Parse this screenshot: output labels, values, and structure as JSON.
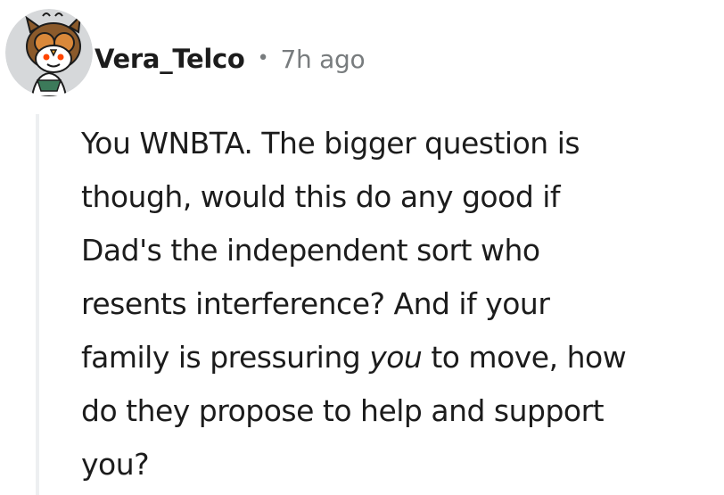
{
  "comment": {
    "author": "Vera_Telco",
    "separator": "•",
    "timestamp": "7h ago",
    "avatar_icon": "owl-snoo-avatar",
    "body_lines": [
      "You WNBTA. The bigger question is",
      "though, would this do any good if",
      "Dad's the independent sort who",
      "resents interference? And if your"
    ],
    "line5_before": "family is pressuring ",
    "line5_emphasis": "you",
    "line5_after": " to move, how",
    "body_lines_end": [
      "do they propose to help and support",
      "you?"
    ]
  },
  "colors": {
    "text": "#1c1c1c",
    "meta": "#787c7e",
    "thread_line": "#edeff1",
    "owl_brown": "#8b5a2b",
    "owl_orange": "#d9883a",
    "avatar_bg": "#d6d8da"
  }
}
